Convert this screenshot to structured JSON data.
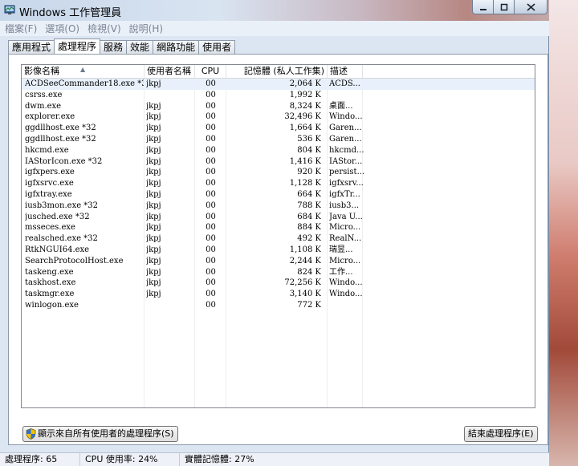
{
  "window": {
    "title": "Windows 工作管理員"
  },
  "menu": [
    "檔案(F)",
    "選項(O)",
    "檢視(V)",
    "說明(H)"
  ],
  "tabs": [
    "應用程式",
    "處理程序",
    "服務",
    "效能",
    "網路功能",
    "使用者"
  ],
  "active_tab": "處理程序",
  "columns": [
    "影像名稱",
    "使用者名稱",
    "CPU",
    "記憶體 (私人工作集)",
    "描述"
  ],
  "processes": [
    {
      "name": "ACDSeeCommander18.exe *32",
      "user": "jkpj",
      "cpu": "00",
      "mem": "2,064 K",
      "desc": "ACDS..."
    },
    {
      "name": "csrss.exe",
      "user": "",
      "cpu": "00",
      "mem": "1,992 K",
      "desc": ""
    },
    {
      "name": "dwm.exe",
      "user": "jkpj",
      "cpu": "00",
      "mem": "8,324 K",
      "desc": "桌面..."
    },
    {
      "name": "explorer.exe",
      "user": "jkpj",
      "cpu": "00",
      "mem": "32,496 K",
      "desc": "Windo..."
    },
    {
      "name": "ggdllhost.exe *32",
      "user": "jkpj",
      "cpu": "00",
      "mem": "1,664 K",
      "desc": "Garen..."
    },
    {
      "name": "ggdllhost.exe *32",
      "user": "jkpj",
      "cpu": "00",
      "mem": "536 K",
      "desc": "Garen..."
    },
    {
      "name": "hkcmd.exe",
      "user": "jkpj",
      "cpu": "00",
      "mem": "804 K",
      "desc": "hkcmd..."
    },
    {
      "name": "IAStorIcon.exe *32",
      "user": "jkpj",
      "cpu": "00",
      "mem": "1,416 K",
      "desc": "IAStor..."
    },
    {
      "name": "igfxpers.exe",
      "user": "jkpj",
      "cpu": "00",
      "mem": "920 K",
      "desc": "persist..."
    },
    {
      "name": "igfxsrvc.exe",
      "user": "jkpj",
      "cpu": "00",
      "mem": "1,128 K",
      "desc": "igfxsrv..."
    },
    {
      "name": "igfxtray.exe",
      "user": "jkpj",
      "cpu": "00",
      "mem": "664 K",
      "desc": "igfxTr..."
    },
    {
      "name": "iusb3mon.exe *32",
      "user": "jkpj",
      "cpu": "00",
      "mem": "788 K",
      "desc": "iusb3..."
    },
    {
      "name": "jusched.exe *32",
      "user": "jkpj",
      "cpu": "00",
      "mem": "684 K",
      "desc": "Java U..."
    },
    {
      "name": "msseces.exe",
      "user": "jkpj",
      "cpu": "00",
      "mem": "884 K",
      "desc": "Micro..."
    },
    {
      "name": "realsched.exe *32",
      "user": "jkpj",
      "cpu": "00",
      "mem": "492 K",
      "desc": "RealN..."
    },
    {
      "name": "RtkNGUI64.exe",
      "user": "jkpj",
      "cpu": "00",
      "mem": "1,108 K",
      "desc": "瑞昱..."
    },
    {
      "name": "SearchProtocolHost.exe",
      "user": "jkpj",
      "cpu": "00",
      "mem": "2,244 K",
      "desc": "Micro..."
    },
    {
      "name": "taskeng.exe",
      "user": "jkpj",
      "cpu": "00",
      "mem": "824 K",
      "desc": "工作..."
    },
    {
      "name": "taskhost.exe",
      "user": "jkpj",
      "cpu": "00",
      "mem": "72,256 K",
      "desc": "Windo..."
    },
    {
      "name": "taskmgr.exe",
      "user": "jkpj",
      "cpu": "00",
      "mem": "3,140 K",
      "desc": "Windo..."
    },
    {
      "name": "winlogon.exe",
      "user": "",
      "cpu": "00",
      "mem": "772 K",
      "desc": ""
    }
  ],
  "buttons": {
    "show_all": "顯示來自所有使用者的處理程序(S)",
    "end_process": "結束處理程序(E)"
  },
  "status": {
    "processes": "處理程序: 65",
    "cpu": "CPU 使用率: 24%",
    "memory": "實體記憶體: 27%"
  }
}
